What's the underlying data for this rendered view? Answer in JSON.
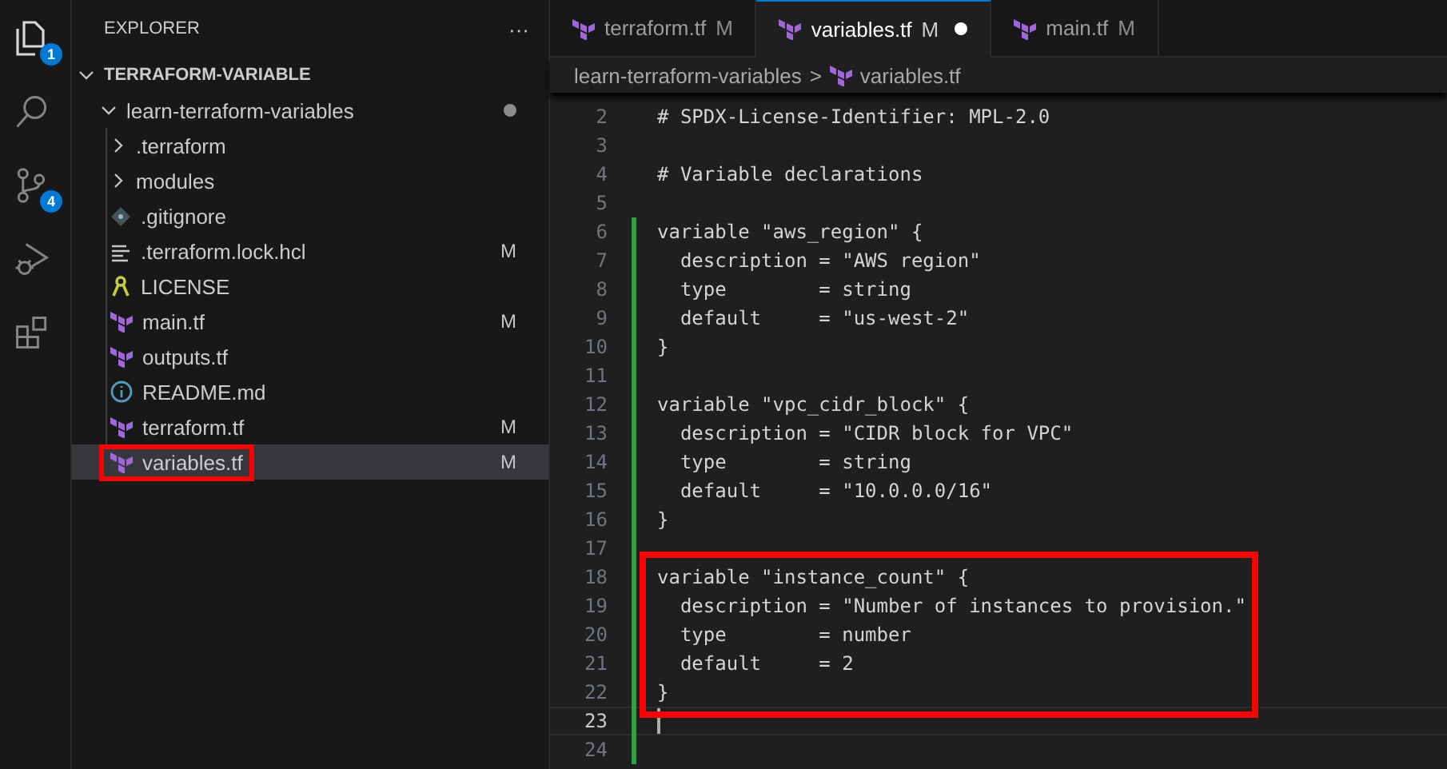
{
  "activity_bar": [
    {
      "kind": "files",
      "badge": "1",
      "selected": true
    },
    {
      "kind": "search",
      "selected": false
    },
    {
      "kind": "source-control",
      "badge": "4",
      "selected": false
    },
    {
      "kind": "run",
      "selected": false
    },
    {
      "kind": "extensions",
      "selected": false
    }
  ],
  "sidebar": {
    "title": "EXPLORER",
    "more": "···",
    "workspace": {
      "label": "TERRAFORM-VARIABLE",
      "expanded": true
    },
    "folder": {
      "label": "learn-terraform-variables",
      "expanded": true,
      "modified_dot": true,
      "children": [
        {
          "kind": "folder",
          "label": ".terraform",
          "expanded": false,
          "selected": false,
          "highlighted": false
        },
        {
          "kind": "folder",
          "label": "modules",
          "expanded": false,
          "selected": false,
          "highlighted": false
        },
        {
          "kind": "git",
          "label": ".gitignore",
          "selected": false,
          "highlighted": false
        },
        {
          "kind": "lines",
          "label": ".terraform.lock.hcl",
          "badge": "M",
          "selected": false,
          "highlighted": false
        },
        {
          "kind": "license",
          "label": "LICENSE",
          "selected": false,
          "highlighted": false
        },
        {
          "kind": "terraform",
          "label": "main.tf",
          "badge": "M",
          "selected": false,
          "highlighted": false
        },
        {
          "kind": "terraform",
          "label": "outputs.tf",
          "selected": false,
          "highlighted": false
        },
        {
          "kind": "info",
          "label": "README.md",
          "selected": false,
          "highlighted": false
        },
        {
          "kind": "terraform",
          "label": "terraform.tf",
          "badge": "M",
          "selected": false,
          "highlighted": false
        },
        {
          "kind": "terraform",
          "label": "variables.tf",
          "badge": "M",
          "selected": true,
          "highlighted": true
        }
      ]
    }
  },
  "tabs": [
    {
      "label": "terraform.tf",
      "badge": "M",
      "selected": false,
      "unsaved": false
    },
    {
      "label": "variables.tf",
      "badge": "M",
      "selected": true,
      "unsaved": true
    },
    {
      "label": "main.tf",
      "badge": "M",
      "selected": false,
      "unsaved": false
    }
  ],
  "breadcrumb": {
    "folder": "learn-terraform-variables",
    "separator": ">",
    "file": "variables.tf"
  },
  "code": {
    "lines_before": [
      {
        "number": "2",
        "text": "# SPDX-License-Identifier: MPL-2.0",
        "added": false,
        "current": false
      },
      {
        "number": "3",
        "added": false,
        "current": false
      },
      {
        "number": "4",
        "text": "# Variable declarations",
        "added": false,
        "current": false
      },
      {
        "number": "5",
        "added": false,
        "current": false
      },
      {
        "number": "6",
        "text": "variable \"aws_region\" {",
        "added": true,
        "current": false
      },
      {
        "number": "7",
        "text": "  description = \"AWS region\"",
        "added": true,
        "current": false
      },
      {
        "number": "8",
        "text": "  type        = string",
        "added": true,
        "current": false
      },
      {
        "number": "9",
        "text": "  default     = \"us-west-2\"",
        "added": true,
        "current": false
      },
      {
        "number": "10",
        "text": "}",
        "added": true,
        "current": false
      },
      {
        "number": "11",
        "added": true,
        "current": false
      },
      {
        "number": "12",
        "text": "variable \"vpc_cidr_block\" {",
        "added": true,
        "current": false
      },
      {
        "number": "13",
        "text": "  description = \"CIDR block for VPC\"",
        "added": true,
        "current": false
      },
      {
        "number": "14",
        "text": "  type        = string",
        "added": true,
        "current": false
      },
      {
        "number": "15",
        "text": "  default     = \"10.0.0.0/16\"",
        "added": true,
        "current": false
      },
      {
        "number": "16",
        "text": "}",
        "added": true,
        "current": false
      },
      {
        "number": "17",
        "added": true,
        "current": false
      }
    ],
    "highlighted_lines": [
      {
        "number": "18",
        "text": "variable \"instance_count\" {",
        "added": true,
        "current": false
      },
      {
        "number": "19",
        "text": "  description = \"Number of instances to provision.\"",
        "added": true,
        "current": false
      },
      {
        "number": "20",
        "text": "  type        = number",
        "added": true,
        "current": false
      },
      {
        "number": "21",
        "text": "  default     = 2",
        "added": true,
        "current": false
      },
      {
        "number": "22",
        "text": "}",
        "added": true,
        "current": false
      }
    ],
    "lines_after": [
      {
        "number": "23",
        "added": true,
        "current": true
      },
      {
        "number": "24",
        "added": true,
        "current": false
      }
    ]
  }
}
